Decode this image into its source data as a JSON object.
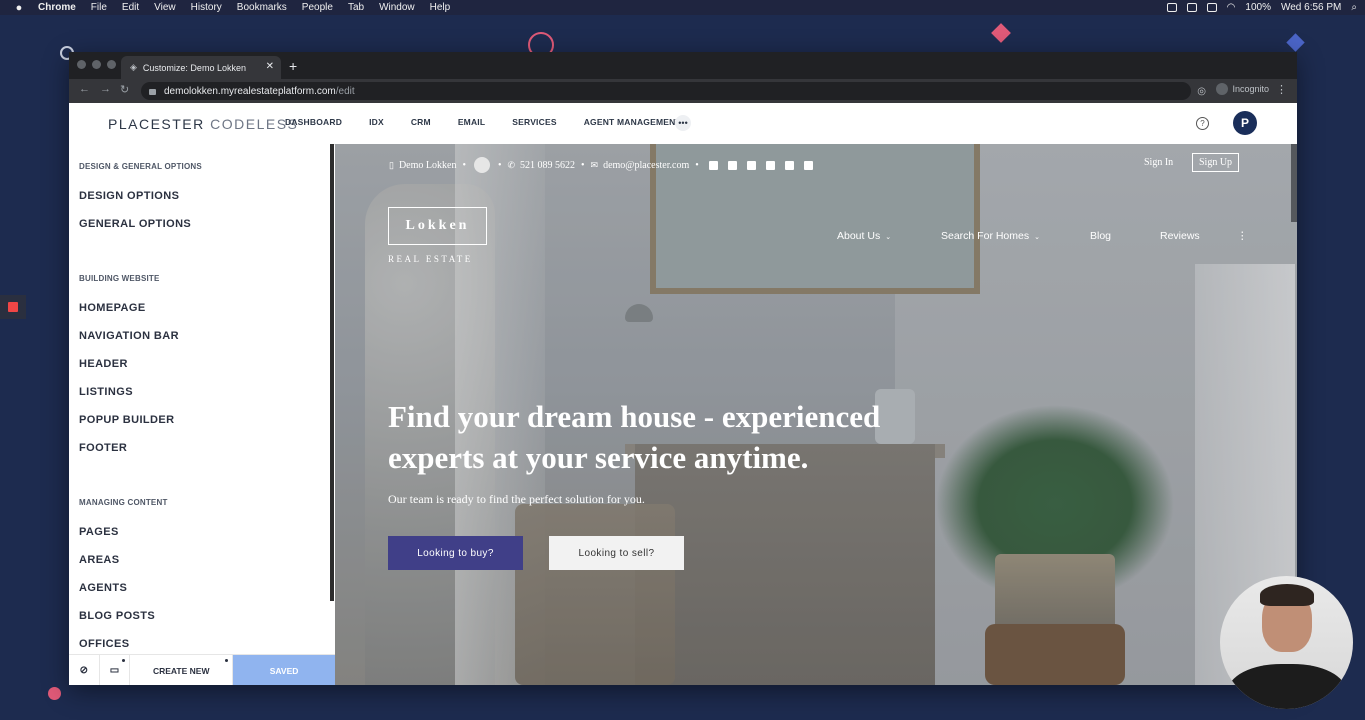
{
  "os_menubar": {
    "app": "Chrome",
    "menus": [
      "File",
      "Edit",
      "View",
      "History",
      "Bookmarks",
      "People",
      "Tab",
      "Window",
      "Help"
    ],
    "clock": "Wed 6:56 PM",
    "battery": "100%"
  },
  "browser": {
    "tab_title": "Customize: Demo Lokken",
    "url_host": "demolokken.myrealestateplatform.com",
    "url_path": "/edit",
    "profile": "Incognito"
  },
  "app": {
    "brand_main": "PLACESTER",
    "brand_sub": "CODELESS",
    "nav": [
      "DASHBOARD",
      "IDX",
      "CRM",
      "EMAIL",
      "SERVICES",
      "AGENT MANAGEMENT"
    ],
    "more": "•••",
    "help": "?",
    "avatar": "P"
  },
  "sidebar": {
    "section1": "DESIGN & GENERAL OPTIONS",
    "design_options": "DESIGN OPTIONS",
    "general_options": "GENERAL OPTIONS",
    "section2": "BUILDING WEBSITE",
    "homepage": "HOMEPAGE",
    "navigation_bar": "NAVIGATION BAR",
    "header": "HEADER",
    "listings": "LISTINGS",
    "popup_builder": "POPUP BUILDER",
    "footer": "FOOTER",
    "section3": "MANAGING CONTENT",
    "pages": "PAGES",
    "areas": "AREAS",
    "agents": "AGENTS",
    "blog_posts": "BLOG POSTS",
    "offices": "OFFICES",
    "create_new": "CREATE NEW",
    "saved": "SAVED"
  },
  "site": {
    "top_name": "Demo Lokken",
    "phone": "521 089 5622",
    "email": "demo@placester.com",
    "sign_in": "Sign In",
    "sign_up": "Sign Up",
    "logo": "Lokken",
    "logo_sub": "REAL ESTATE",
    "nav_about": "About Us",
    "nav_search": "Search For Homes",
    "nav_blog": "Blog",
    "nav_reviews": "Reviews",
    "hero_title": "Find your dream house - experienced experts at your service anytime.",
    "hero_subtitle": "Our team is ready to find the perfect solution for you.",
    "btn_buy": "Looking to buy?",
    "btn_sell": "Looking to sell?"
  },
  "colors": {
    "desktop_bg": "#1d2b4f",
    "buy_button": "#403f88",
    "saved_button": "#90b4ef",
    "avatar_bg": "#1a2e5a"
  }
}
